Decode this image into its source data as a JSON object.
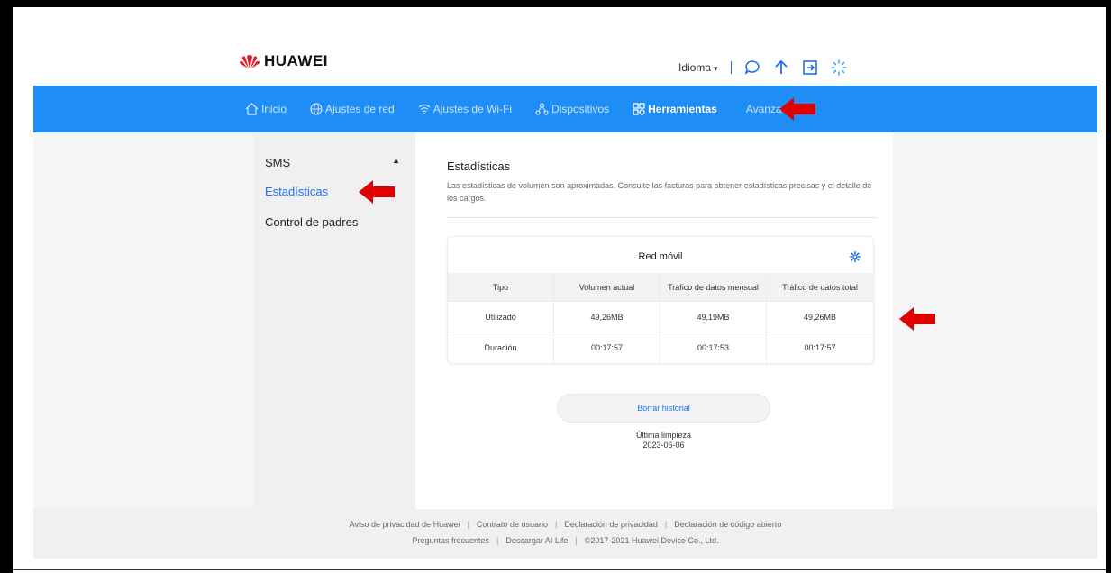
{
  "brand": {
    "name": "HUAWEI"
  },
  "header": {
    "language_label": "Idioma",
    "icons": [
      "chat-icon",
      "upload-icon",
      "logout-icon",
      "loading-icon"
    ]
  },
  "nav": {
    "items": [
      {
        "label": "Inicio",
        "icon": "home-icon"
      },
      {
        "label": "Ajustes de red",
        "icon": "globe-icon"
      },
      {
        "label": "Ajustes de Wi-Fi",
        "icon": "wifi-icon"
      },
      {
        "label": "Dispositivos",
        "icon": "devices-icon"
      },
      {
        "label": "Herramientas",
        "icon": "tools-icon",
        "active": true
      },
      {
        "label": "Avanzados",
        "icon": ""
      }
    ]
  },
  "sidebar": {
    "section": "SMS",
    "items": [
      {
        "label": "Estadísticas",
        "active": true
      },
      {
        "label": "Control de padres"
      }
    ]
  },
  "main": {
    "title": "Estadísticas",
    "description": "Las estadísticas de volumen son aproximadas. Consulte las facturas para obtener estadísticas precisas y el detalle de los cargos.",
    "card": {
      "title": "Red móvil",
      "columns": [
        "Tipo",
        "Volumen actual",
        "Tráfico de datos mensual",
        "Tráfico de datos total"
      ],
      "rows": [
        [
          "Utilizado",
          "49,26MB",
          "49,19MB",
          "49,26MB"
        ],
        [
          "Duración",
          "00:17:57",
          "00:17:53",
          "00:17:57"
        ]
      ]
    },
    "clear_button": "Borrar historial",
    "last_clean_label": "Última limpieza",
    "last_clean_date": "2023-06-06"
  },
  "footer": {
    "line1": [
      "Aviso de privacidad de Huawei",
      "Contrato de usuario",
      "Declaración de privacidad",
      "Declaración de código abierto"
    ],
    "line2": [
      "Preguntas frecuentes",
      "Descargar AI Life",
      "©2017-2021 Huawei Device Co., Ltd."
    ]
  },
  "colors": {
    "nav_bg": "#1e8df5",
    "accent": "#1e6ff5",
    "annotation": "#e00000"
  }
}
